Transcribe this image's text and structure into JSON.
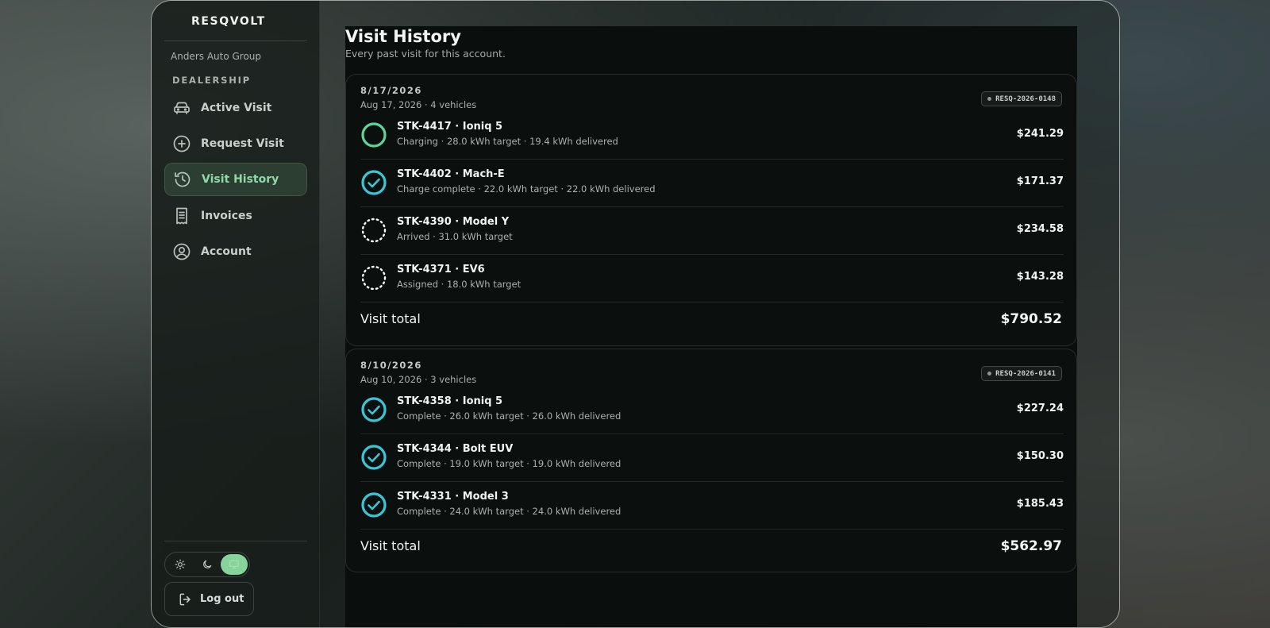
{
  "app": {
    "brand": "RESQVOLT"
  },
  "sidebar": {
    "org": "Anders Auto Group",
    "section": "DEALERSHIP",
    "items": [
      {
        "label": "Active Visit",
        "icon": "car-icon"
      },
      {
        "label": "Request Visit",
        "icon": "plus-circle-icon"
      },
      {
        "label": "Visit History",
        "icon": "history-icon",
        "active": true
      },
      {
        "label": "Invoices",
        "icon": "receipt-icon"
      },
      {
        "label": "Account",
        "icon": "user-circle-icon"
      }
    ],
    "theme": {
      "options": [
        "light",
        "dark",
        "system"
      ],
      "selected": "system"
    },
    "logout_label": "Log out"
  },
  "page": {
    "title": "Visit History",
    "subtitle": "Every past visit for this account."
  },
  "visits": [
    {
      "date": "8/17/2026",
      "meta": "Aug 17, 2026 · 4 vehicles",
      "badge": "RESQ-2026-0148",
      "vehicles": [
        {
          "title": "STK-4417 · Ioniq 5",
          "detail": "Charging · 28.0 kWh target · 19.4 kWh delivered",
          "price": "$241.29",
          "status": "charging"
        },
        {
          "title": "STK-4402 · Mach-E",
          "detail": "Charge complete · 22.0 kWh target · 22.0 kWh delivered",
          "price": "$171.37",
          "status": "complete"
        },
        {
          "title": "STK-4390 · Model Y",
          "detail": "Arrived · 31.0 kWh target",
          "price": "$234.58",
          "status": "pending"
        },
        {
          "title": "STK-4371 · EV6",
          "detail": "Assigned · 18.0 kWh target",
          "price": "$143.28",
          "status": "pending"
        }
      ],
      "total_label": "Visit total",
      "total": "$790.52"
    },
    {
      "date": "8/10/2026",
      "meta": "Aug 10, 2026 · 3 vehicles",
      "badge": "RESQ-2026-0141",
      "vehicles": [
        {
          "title": "STK-4358 · Ioniq 5",
          "detail": "Complete · 26.0 kWh target · 26.0 kWh delivered",
          "price": "$227.24",
          "status": "complete"
        },
        {
          "title": "STK-4344 · Bolt EUV",
          "detail": "Complete · 19.0 kWh target · 19.0 kWh delivered",
          "price": "$150.30",
          "status": "complete"
        },
        {
          "title": "STK-4331 · Model 3",
          "detail": "Complete · 24.0 kWh target · 24.0 kWh delivered",
          "price": "$185.43",
          "status": "complete"
        }
      ],
      "total_label": "Visit total",
      "total": "$562.97"
    }
  ],
  "colors": {
    "accent": "#86d39b",
    "charging": "#5fd49a",
    "complete": "#38c7d6",
    "pending": "#ffffff"
  }
}
